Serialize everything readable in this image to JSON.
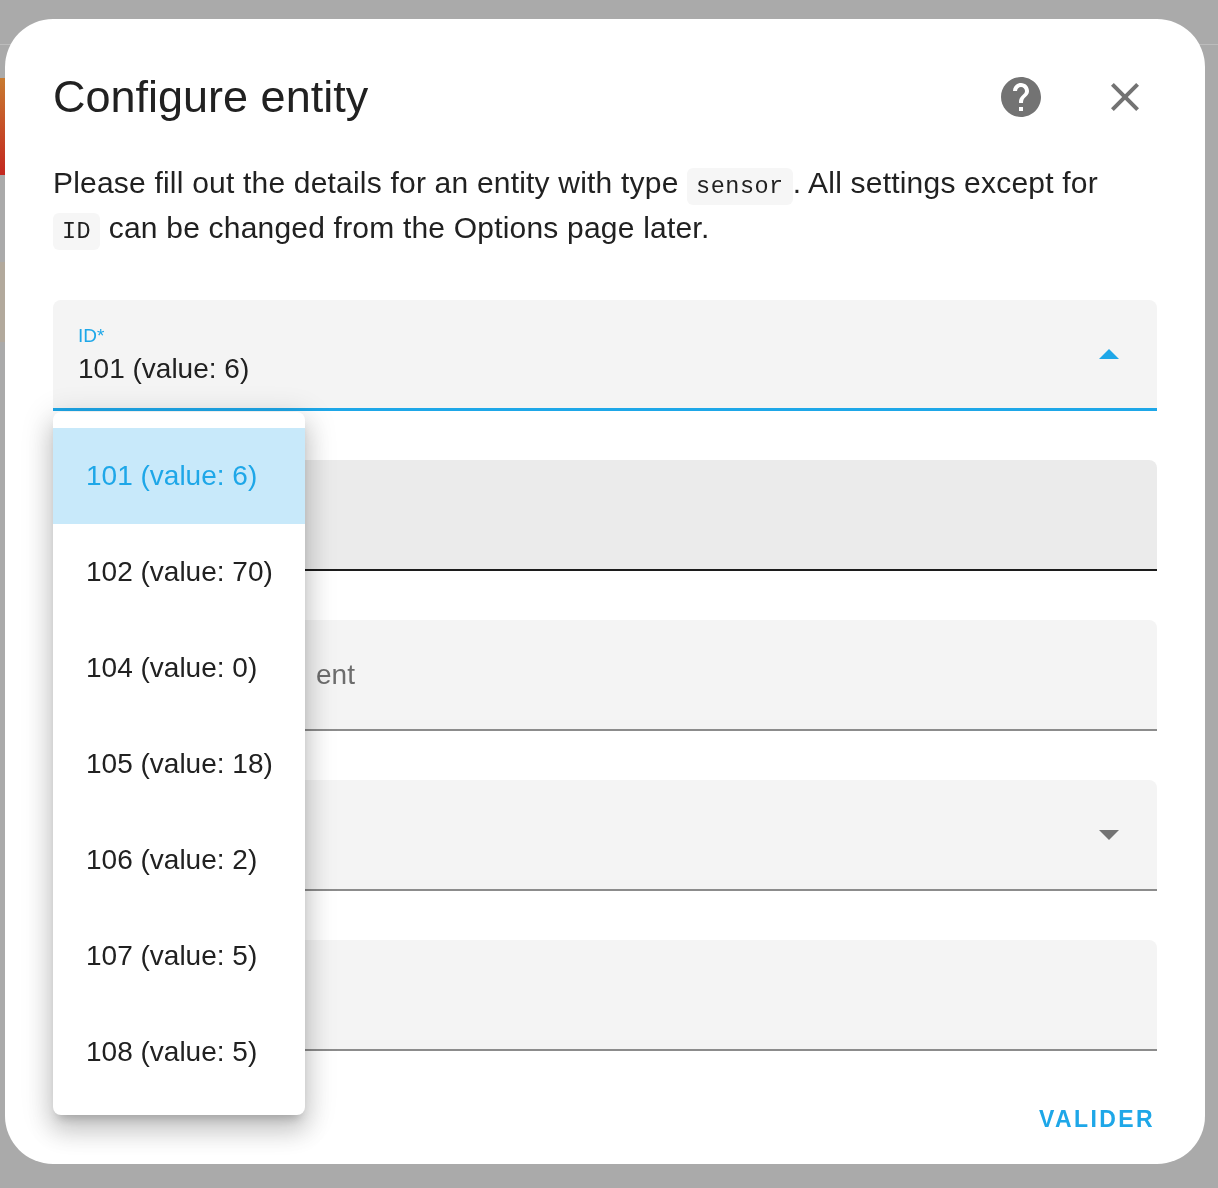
{
  "dialog": {
    "title": "Configure entity"
  },
  "description": [
    {
      "kind": "text",
      "text": "Please fill out the details for an entity with type "
    },
    {
      "kind": "code",
      "text": "sensor"
    },
    {
      "kind": "text",
      "text": ". All settings except for "
    },
    {
      "kind": "code",
      "text": "ID"
    },
    {
      "kind": "text",
      "text": " can be changed from the Options page later."
    }
  ],
  "fields": [
    {
      "kind": "select",
      "label": "ID*",
      "value": "101 (value: 6)",
      "focused": true,
      "hovered": false,
      "expanded": true,
      "options": [
        {
          "label": "101 (value: 6)",
          "selected": true
        },
        {
          "label": "102 (value: 70)",
          "selected": false
        },
        {
          "label": "104 (value: 0)",
          "selected": false
        },
        {
          "label": "105 (value: 18)",
          "selected": false
        },
        {
          "label": "106 (value: 2)",
          "selected": false
        },
        {
          "label": "107 (value: 5)",
          "selected": false
        },
        {
          "label": "108 (value: 5)",
          "selected": false
        }
      ]
    },
    {
      "kind": "text",
      "focused": false,
      "hovered": true
    },
    {
      "kind": "text",
      "label": "ent",
      "focused": false,
      "hovered": false
    },
    {
      "kind": "select",
      "focused": false,
      "hovered": false,
      "expanded": false
    },
    {
      "kind": "text",
      "focused": false,
      "hovered": false
    }
  ],
  "actions": [
    {
      "label": "VALIDER"
    }
  ]
}
